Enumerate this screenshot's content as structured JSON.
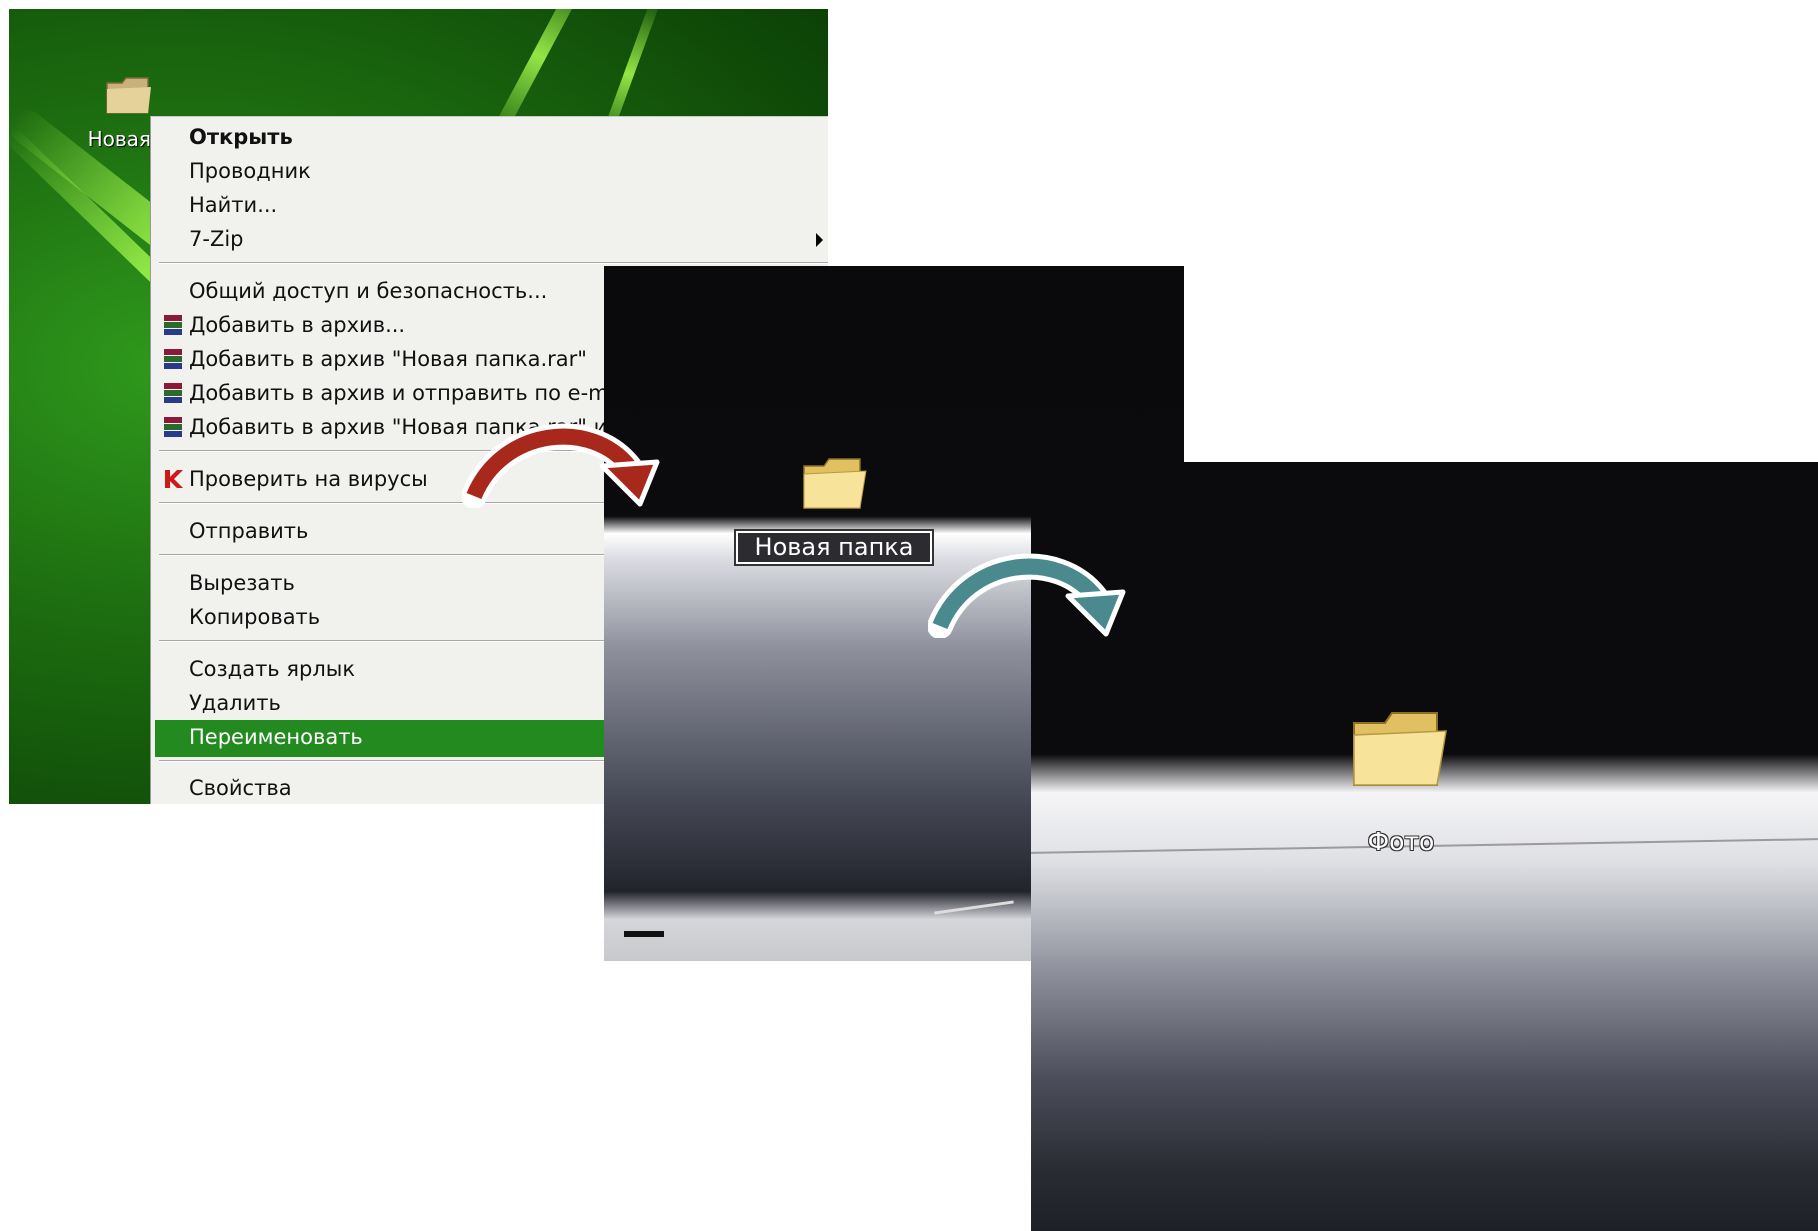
{
  "desktop": {
    "folder_label": "Новая п"
  },
  "context_menu": {
    "items": [
      {
        "label": "Открыть"
      },
      {
        "label": "Проводник"
      },
      {
        "label": "Найти..."
      },
      {
        "label": "7-Zip"
      },
      {
        "label": "Общий доступ и безопасность..."
      },
      {
        "label": "Добавить в архив..."
      },
      {
        "label": "Добавить в архив \"Новая папка.rar\""
      },
      {
        "label": "Добавить в архив и отправить по e-mail..."
      },
      {
        "label": "Добавить в архив \"Новая папка.rar\" и отп"
      },
      {
        "label": "Проверить на вирусы"
      },
      {
        "label": "Отправить"
      },
      {
        "label": "Вырезать"
      },
      {
        "label": "Копировать"
      },
      {
        "label": "Создать ярлык"
      },
      {
        "label": "Удалить"
      },
      {
        "label": "Переименовать"
      },
      {
        "label": "Свойства"
      }
    ],
    "highlighted_item": "Переименовать"
  },
  "rename_step": {
    "edit_value": "Новая папка"
  },
  "result_step": {
    "folder_label": "Фото"
  },
  "colors": {
    "menu_highlight": "#238a1f",
    "arrow_red": "#a8281c",
    "arrow_teal": "#4a8a8f"
  }
}
